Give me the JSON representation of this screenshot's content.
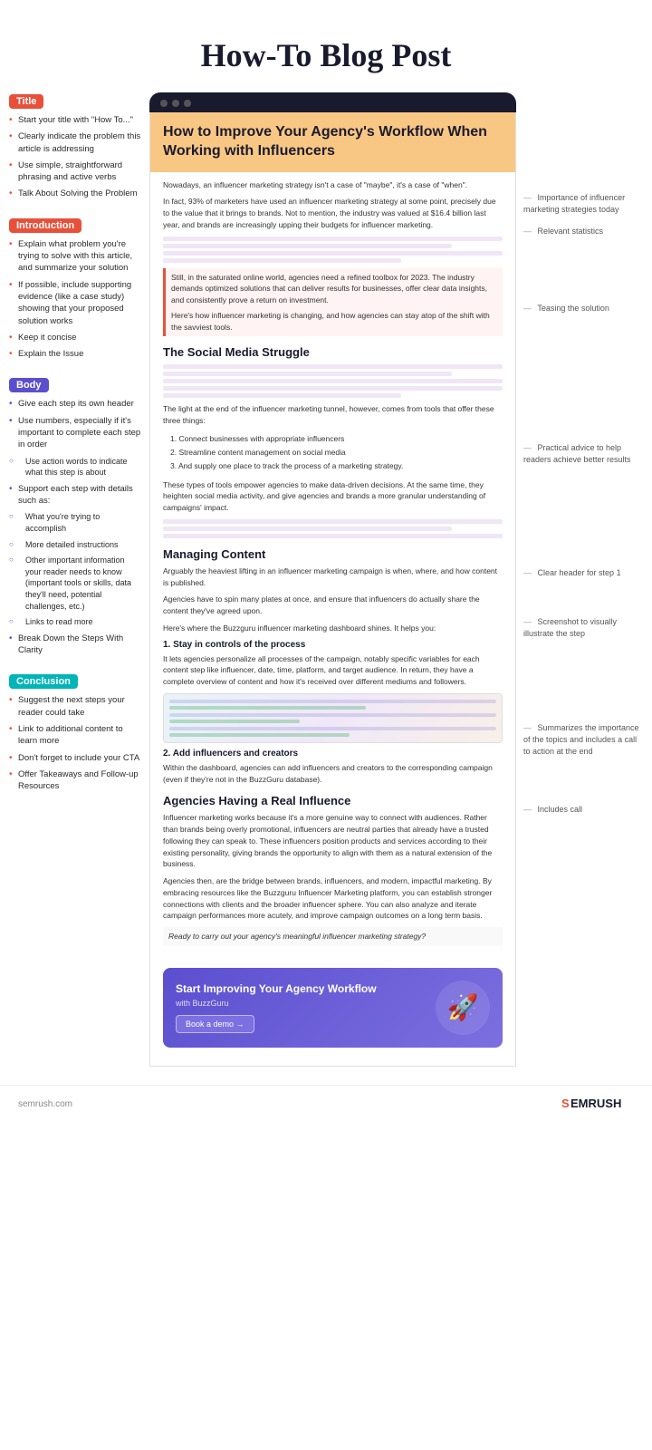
{
  "page": {
    "title": "How-To Blog Post",
    "footer_site": "semrush.com",
    "footer_logo": "SEMRUSH"
  },
  "browser": {
    "dots": [
      "dot1",
      "dot2",
      "dot3"
    ]
  },
  "article": {
    "title": "How to Improve Your Agency's Workflow When Working with Influencers",
    "intro_para1": "Nowadays, an influencer marketing strategy isn't a case of \"maybe\", it's a case of \"when\".",
    "intro_para2": "In fact, 93% of marketers have used an influencer marketing strategy at some point, precisely due to the value that it brings to brands. Not to mention, the industry was valued at $16.4 billion last year, and brands are increasingly upping their budgets for influencer marketing.",
    "teasing_para": "Still, in the saturated online world, agencies need a refined toolbox for 2023. The industry demands optimized solutions that can deliver results for businesses, offer clear data insights, and consistently prove a return on investment.",
    "teasing_para2": "Here's how influencer marketing is changing, and how agencies can stay atop of the shift with the savviest tools.",
    "section1_title": "The Social Media Struggle",
    "section1_para1": "The light at the end of the influencer marketing tunnel, however, comes from tools that offer these three things:",
    "section1_list": [
      "1. Connect businesses with appropriate influencers",
      "2. Streamline content management on social media",
      "3. And supply one place to track the process of a marketing strategy."
    ],
    "section1_para2": "These types of tools empower agencies to make data-driven decisions. At the same time, they heighten social media activity, and give agencies and brands a more granular understanding of campaigns' impact.",
    "section2_title": "Managing Content",
    "section2_para1": "Arguably the heaviest lifting in an influencer marketing campaign is when, where, and how content is published.",
    "section2_para2": "Agencies have to spin many plates at once, and ensure that influencers do actually share the content they've agreed upon.",
    "section2_para3": "Here's where the Buzzguru influencer marketing dashboard shines. It helps you:",
    "step1_title": "1. Stay in controls of the process",
    "step1_para": "It lets agencies personalize all processes of the campaign, notably specific variables for each content step like influencer, date, time, platform, and target audience. In return, they have a complete overview of content and how it's received over different mediums and followers.",
    "step2_title": "2. Add influencers and creators",
    "step2_para": "Within the dashboard, agencies can add influencers and creators to the corresponding campaign (even if they're not in the BuzzGuru database).",
    "section3_title": "Agencies Having a Real Influence",
    "section3_para1": "Influencer marketing works because it's a more genuine way to connect with audiences. Rather than brands being overly promotional, influencers are neutral parties that already have a trusted following they can speak to. These influencers position products and services according to their existing personality, giving brands the opportunity to align with them as a natural extension of the business.",
    "section3_para2": "Agencies then, are the bridge between brands, influencers, and modern, impactful marketing. By embracing resources like the Buzzguru Influencer Marketing platform, you can establish stronger connections with clients and the broader influencer sphere. You can also analyze and iterate campaign performances more acutely, and improve campaign outcomes on a long term basis.",
    "section3_cta": "Ready to carry out your agency's meaningful influencer marketing strategy?",
    "cta_box_title": "Start Improving Your Agency Workflow",
    "cta_box_subtitle": "with BuzzGuru",
    "cta_button": "Book a demo →"
  },
  "left_sidebar": {
    "title_tag": "Title",
    "title_items": [
      "Start your title with \"How To...\"",
      "Clearly indicate the problem this article is addressing",
      "Use simple, straightforward phrasing and active verbs",
      "Talk About Solving the Problem"
    ],
    "intro_tag": "Introduction",
    "intro_items": [
      "Explain what problem you're trying to solve with this article, and summarize your solution",
      "If possible, include supporting evidence (like a case study) showing that your proposed solution works",
      "Keep it concise",
      "Explain the Issue"
    ],
    "body_tag": "Body",
    "body_items": [
      "Give each step its own header",
      "Use numbers, especially if it's important to complete each step in order",
      "Use action words to indicate what this step is about",
      "Support each step with details such as:",
      "What you're trying to accomplish",
      "More detailed instructions",
      "Other important information your reader needs to know (important tools or skills, data they'll need, potential challenges, etc.)",
      "Links to read more",
      "Break Down the Steps With Clarity"
    ],
    "conclusion_tag": "Conclusion",
    "conclusion_items": [
      "Suggest the next steps your reader could take",
      "Link to additional content to learn more",
      "Don't forget to include your CTA",
      "Offer Takeaways and Follow-up Resources"
    ]
  },
  "right_sidebar": {
    "annotations": [
      "Importance of influencer marketing strategies today",
      "Relevant statistics",
      "Teasing the solution",
      "Practical advice to help readers achieve better results",
      "Clear header for step 1",
      "Screenshot to visually illustrate the step",
      "Summarizes the importance of the topics and includes a call to action at the end",
      "Includes call"
    ]
  }
}
